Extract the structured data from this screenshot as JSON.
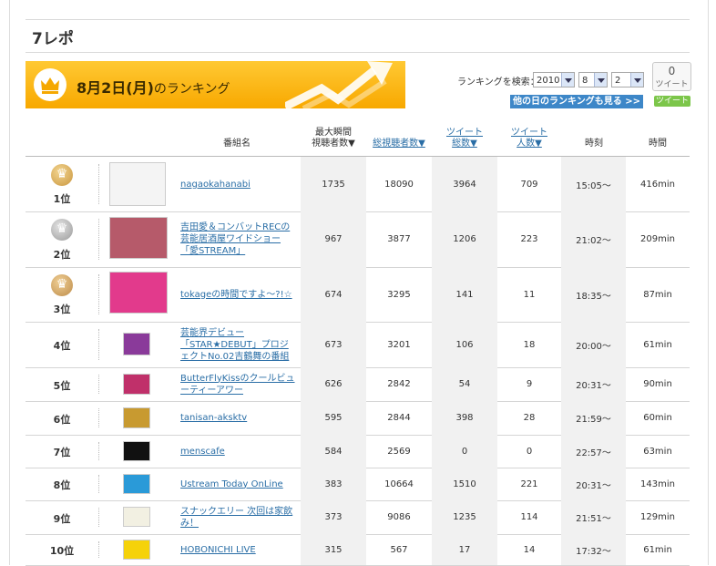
{
  "page_title": "7レポ",
  "banner": {
    "date": "8月2日(月)",
    "suffix": "のランキング"
  },
  "search": {
    "label": "ランキングを検索：",
    "year": "2010",
    "month": "8",
    "day": "2"
  },
  "tweet_box": {
    "count": "0",
    "label": "ツイート"
  },
  "other_day_button": "他の日のランキングも見る >>",
  "tweet_button": "ツイート",
  "columns": {
    "program": "番組名",
    "peak_line1": "最大瞬間",
    "peak_line2": "視聴者数▼",
    "total_viewers": "総視聴者数▼",
    "tweets_line1": "ツイート",
    "tweets_line2": "総数▼",
    "tweeters_line1": "ツイート",
    "tweeters_line2": "人数▼",
    "time": "時刻",
    "duration": "時間"
  },
  "rows": [
    {
      "rank": "1位",
      "medal": "gold",
      "name": "nagaokahanabi",
      "peak": "1735",
      "total": "18090",
      "tweets": "3964",
      "people": "709",
      "time": "15:05〜",
      "duration": "416min",
      "thumb_color": "#f4f4f4"
    },
    {
      "rank": "2位",
      "medal": "silver",
      "name": "吉田愛＆コンバットRECの芸能居酒屋ワイドショー「愛STREAM」",
      "peak": "967",
      "total": "3877",
      "tweets": "1206",
      "people": "223",
      "time": "21:02〜",
      "duration": "209min",
      "thumb_color": "#b65a6a"
    },
    {
      "rank": "3位",
      "medal": "bronze",
      "name": "tokageの時間ですよ〜?!☆",
      "peak": "674",
      "total": "3295",
      "tweets": "141",
      "people": "11",
      "time": "18:35〜",
      "duration": "87min",
      "thumb_color": "#e23a8c"
    },
    {
      "rank": "4位",
      "medal": "",
      "name": "芸能界デビュー「STAR★DEBUT」プロジェクトNo.02吉鶴舞の番組",
      "peak": "673",
      "total": "3201",
      "tweets": "106",
      "people": "18",
      "time": "20:00〜",
      "duration": "61min",
      "thumb_color": "#8a3a9a"
    },
    {
      "rank": "5位",
      "medal": "",
      "name": "ButterFlyKissのクールビューティーアワー",
      "peak": "626",
      "total": "2842",
      "tweets": "54",
      "people": "9",
      "time": "20:31〜",
      "duration": "90min",
      "thumb_color": "#c0306a"
    },
    {
      "rank": "6位",
      "medal": "",
      "name": "tanisan-aksktv",
      "peak": "595",
      "total": "2844",
      "tweets": "398",
      "people": "28",
      "time": "21:59〜",
      "duration": "60min",
      "thumb_color": "#c89a30"
    },
    {
      "rank": "7位",
      "medal": "",
      "name": "menscafe",
      "peak": "584",
      "total": "2569",
      "tweets": "0",
      "people": "0",
      "time": "22:57〜",
      "duration": "63min",
      "thumb_color": "#111111"
    },
    {
      "rank": "8位",
      "medal": "",
      "name": "Ustream Today OnLine",
      "peak": "383",
      "total": "10664",
      "tweets": "1510",
      "people": "221",
      "time": "20:31〜",
      "duration": "143min",
      "thumb_color": "#2a9ad8"
    },
    {
      "rank": "9位",
      "medal": "",
      "name": "スナックエリー 次回は家飲み！",
      "peak": "373",
      "total": "9086",
      "tweets": "1235",
      "people": "114",
      "time": "21:51〜",
      "duration": "129min",
      "thumb_color": "#f2f0e2"
    },
    {
      "rank": "10位",
      "medal": "",
      "name": "HOBONICHI LIVE",
      "peak": "315",
      "total": "567",
      "tweets": "17",
      "people": "14",
      "time": "17:32〜",
      "duration": "61min",
      "thumb_color": "#f5d20a"
    }
  ]
}
